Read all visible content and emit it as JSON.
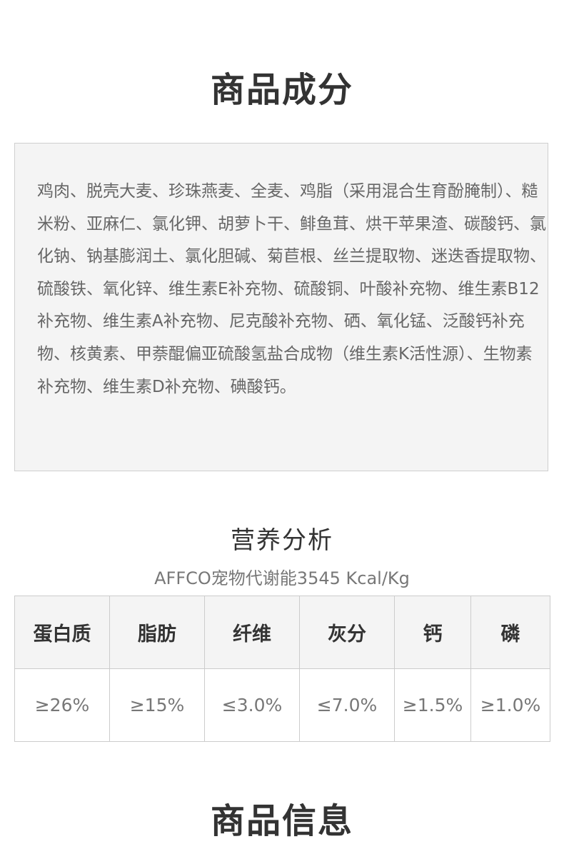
{
  "sections": {
    "ingredients_title": "商品成分",
    "product_info_title": "商品信息"
  },
  "ingredients": {
    "text": "鸡肉、脱壳大麦、珍珠燕麦、全麦、鸡脂（采用混合生育酚腌制）、糙米粉、亚麻仁、氯化钾、胡萝卜干、鲱鱼茸、烘干苹果渣、碳酸钙、氯化钠、钠基膨润土、氯化胆碱、菊苣根、丝兰提取物、迷迭香提取物、硫酸铁、氧化锌、维生素E补充物、硫酸铜、叶酸补充物、维生素B12补充物、维生素A补充物、尼克酸补充物、硒、氧化锰、泛酸钙补充物、核黄素、甲萘醌偏亚硫酸氢盐合成物（维生素K活性源）、生物素补充物、维生素D补充物、碘酸钙。"
  },
  "nutrition": {
    "title": "营养分析",
    "subtitle": "AFFCO宠物代谢能3545 Kcal/Kg",
    "headers": [
      "蛋白质",
      "脂肪",
      "纤维",
      "灰分",
      "钙",
      "磷"
    ],
    "values": [
      "≥26%",
      "≥15%",
      "≤3.0%",
      "≤7.0%",
      "≥1.5%",
      "≥1.0%"
    ]
  }
}
